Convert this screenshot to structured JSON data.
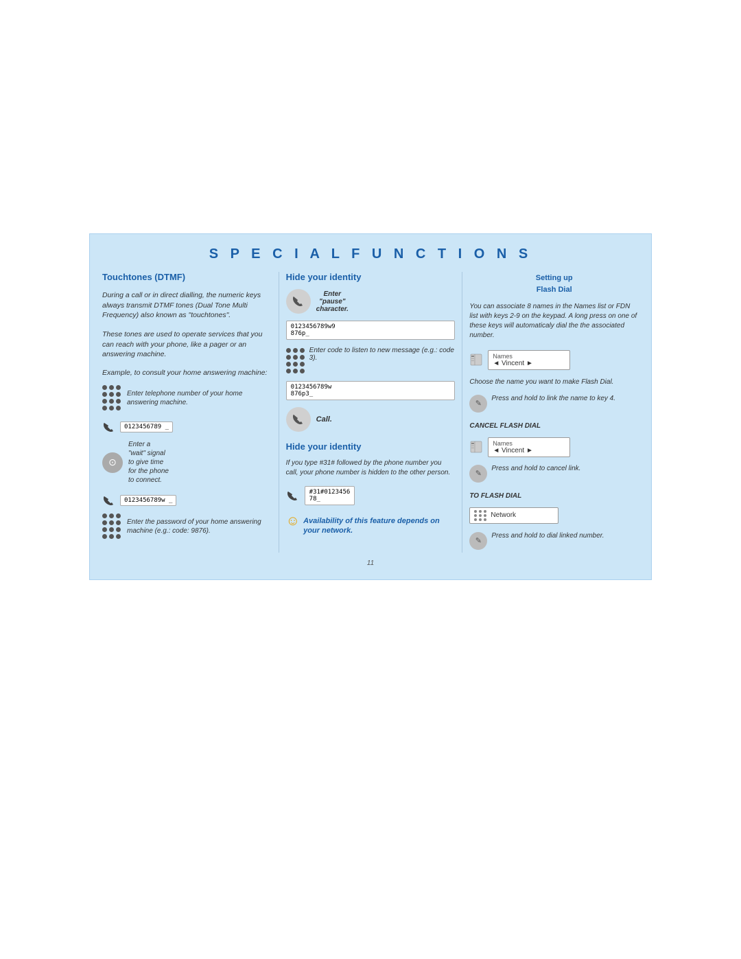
{
  "page": {
    "title": "Special Functions",
    "title_styled": "S P E C I A L   F U N C T I O N S",
    "page_number": "11"
  },
  "col1": {
    "title": "Touchtones (DTMF)",
    "para1": "During a call or in direct dialling, the numeric keys always transmit DTMF tones (Dual Tone Multi Frequency) also known as \"touchtones\".",
    "para2": "These tones are used to operate services that you can reach with your phone, like a pager or an answering machine.",
    "example_label": "Example, to consult your home answering machine:",
    "step1_label": "Enter telephone number of your home answering machine.",
    "display1": "0123456789 _",
    "step2_label": "Enter a \"wait\" signal to give time for the phone to connect.",
    "display2": "0123456789w _",
    "step3_label": "Enter the password of your home answering machine (e.g.: code: 9876)."
  },
  "col2": {
    "title": "Hide your identity",
    "enter_pause_label": "Enter \"pause\" character.",
    "display1": "0123456789w9\n876p_",
    "enter_code_label": "Enter code to listen to new message (e.g.: code 3).",
    "display2": "0123456789w\n876p3_",
    "call_label": "Call.",
    "title2": "Hide your identity",
    "hide_para": "If you type #31# followed by the phone number you call, your phone number is hidden to the other person.",
    "display3": "#31#0123456\n78_",
    "availability": "Availability of this feature depends on your network."
  },
  "col3": {
    "title": "Setting up\nFlash Dial",
    "para": "You can associate 8 names in the Names list or FDN list with keys 2-9 on the keypad. A long press on one of these keys will automaticaly dial the the associated number.",
    "names_label": "Names",
    "vincent_label": "◄ Vincent ►",
    "choose_label": "Choose the name you want to make Flash Dial.",
    "press_hold_label": "Press and hold to link the name to key 4.",
    "cancel_title": "CANCEL FLASH DIAL",
    "cancel_names_label": "Names",
    "cancel_vincent_label": "◄ Vincent ►",
    "cancel_press_hold_label": "Press and hold to cancel link.",
    "to_flash_dial_title": "TO FLASH DIAL",
    "network_label": "Network",
    "final_press_label": "Press and hold to dial linked number.",
    "enter_the": "Enter the"
  }
}
